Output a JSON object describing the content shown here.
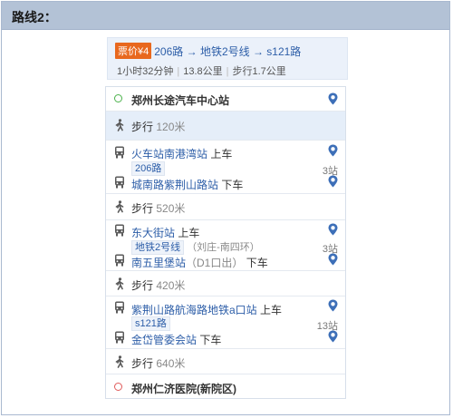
{
  "header": {
    "title": "路线2："
  },
  "summary": {
    "fare": "票价¥4",
    "route": "206路 → 地铁2号线 → s121路",
    "duration": "1小时32分钟",
    "distance": "13.8公里",
    "walk": "步行1.7公里"
  },
  "steps": {
    "start": "郑州长途汽车中心站",
    "walk1": "步行",
    "walk1_dist": "120米",
    "seg1_board": "火车站南港湾站",
    "seg1_board_action": "上车",
    "seg1_line": "206路",
    "seg1_stops": "3站",
    "seg1_alight": "城南路紫荆山路站",
    "seg1_alight_action": "下车",
    "walk2": "步行",
    "walk2_dist": "520米",
    "seg2_board": "东大街站",
    "seg2_board_action": "上车",
    "seg2_line": "地铁2号线",
    "seg2_dir": "（刘庄-南四环）",
    "seg2_stops": "3站",
    "seg2_alight": "南五里堡站",
    "seg2_alight_note": "（D1口出）",
    "seg2_alight_action": "下车",
    "walk3": "步行",
    "walk3_dist": "420米",
    "seg3_board": "紫荆山路航海路地铁a口站",
    "seg3_board_action": "上车",
    "seg3_line": "s121路",
    "seg3_stops": "13站",
    "seg3_alight": "金岱管委会站",
    "seg3_alight_action": "下车",
    "walk4": "步行",
    "walk4_dist": "640米",
    "end": "郑州仁济医院(新院区)"
  },
  "colors": {
    "header_bg": "#b3c2d6",
    "summary_bg": "#ebf1fa",
    "fare_bg": "#e8681e",
    "link": "#2d5ea8",
    "start_dot": "#4bb24b",
    "end_dot": "#e05a5a",
    "highlight_row": "#e5eef9"
  },
  "icons": {
    "start": "start-dot-icon",
    "end": "end-dot-icon",
    "walk": "walk-icon",
    "bus": "bus-icon",
    "locate": "map-pin-icon"
  }
}
